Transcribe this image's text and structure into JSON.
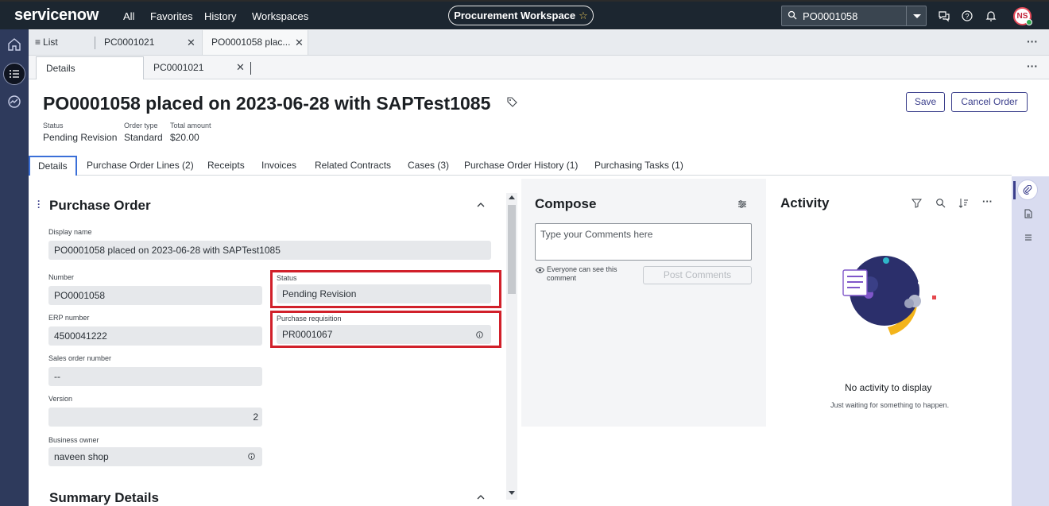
{
  "topnav": {
    "logo_text": "servicenow",
    "menu": [
      "All",
      "Favorites",
      "History",
      "Workspaces"
    ],
    "workspace": "Procurement Workspace",
    "search_value": "PO0001058",
    "avatar_initials": "NS"
  },
  "tabs_row1": {
    "list": "List",
    "tab1": "PC0001021",
    "tab2": "PO0001058 plac..."
  },
  "tabs_row2": {
    "details": "Details",
    "tab1": "PC0001021"
  },
  "record": {
    "title": "PO0001058 placed on 2023-06-28 with SAPTest1085",
    "save": "Save",
    "cancel": "Cancel Order",
    "meta": [
      {
        "label": "Status",
        "value": "Pending Revision"
      },
      {
        "label": "Order type",
        "value": "Standard"
      },
      {
        "label": "Total amount",
        "value": "$20.00"
      }
    ]
  },
  "record_tabs": [
    "Details",
    "Purchase Order Lines (2)",
    "Receipts",
    "Invoices",
    "Related Contracts",
    "Cases (3)",
    "Purchase Order History (1)",
    "Purchasing Tasks (1)"
  ],
  "form": {
    "section_title": "Purchase Order",
    "section2_title": "Summary Details",
    "display_name_label": "Display name",
    "display_name": "PO0001058 placed on 2023-06-28 with SAPTest1085",
    "number_label": "Number",
    "number": "PO0001058",
    "status_label": "Status",
    "status": "Pending Revision",
    "erp_label": "ERP number",
    "erp": "4500041222",
    "pr_label": "Purchase requisition",
    "pr": "PR0001067",
    "sales_label": "Sales order number",
    "sales": "--",
    "version_label": "Version",
    "version": "2",
    "owner_label": "Business owner",
    "owner": "naveen shop"
  },
  "compose": {
    "title": "Compose",
    "placeholder": "Type your Comments here",
    "visibility_note_1": "Everyone can see this",
    "visibility_note_2": "comment",
    "post": "Post Comments"
  },
  "activity": {
    "title": "Activity",
    "empty_title": "No activity to display",
    "empty_sub": "Just waiting for something to happen."
  },
  "colors": {
    "nav_bg": "#1c2630",
    "rail_bg": "#2e3a5c",
    "accent": "#3b3f8c",
    "highlight": "#d1202a"
  }
}
